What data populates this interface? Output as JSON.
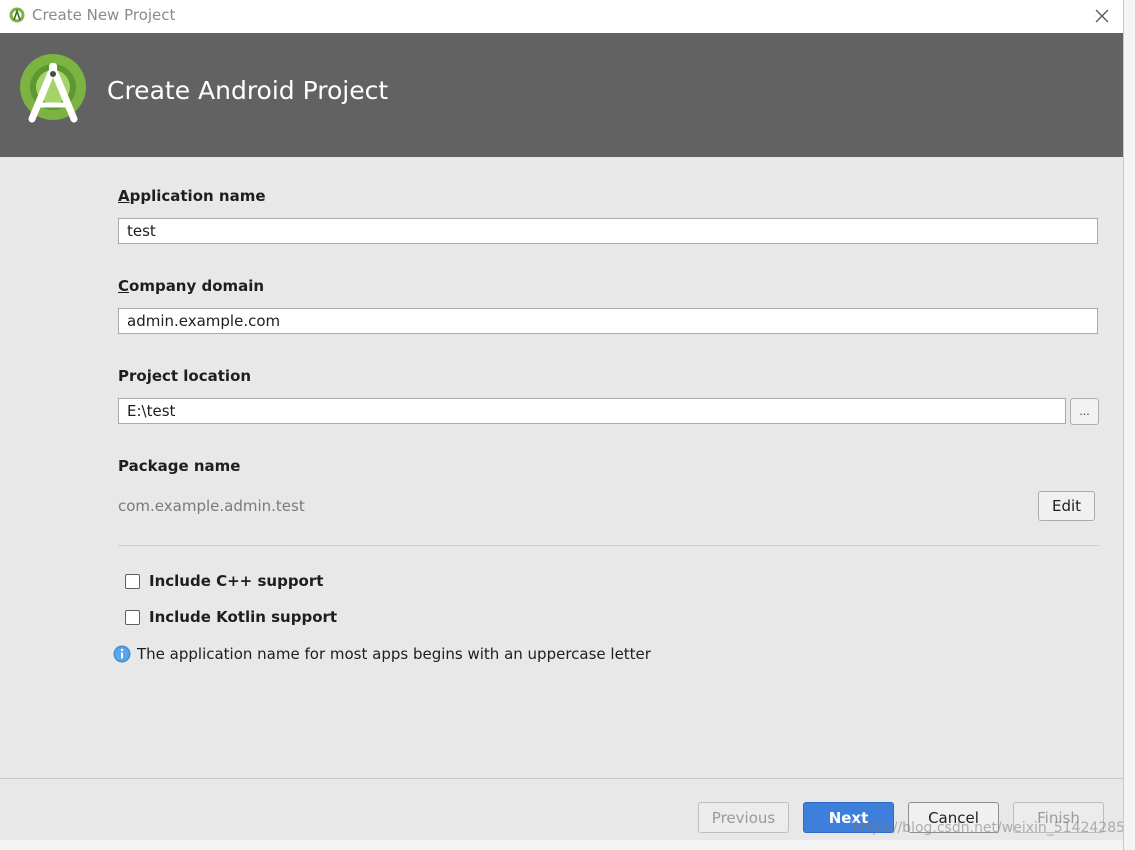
{
  "window": {
    "title": "Create New Project",
    "header_title": "Create Android Project"
  },
  "form": {
    "app_name": {
      "label_accesskey": "A",
      "label_rest": "pplication name",
      "value": "test"
    },
    "company_domain": {
      "label_accesskey": "C",
      "label_rest": "ompany domain",
      "value": "admin.example.com"
    },
    "project_location": {
      "label": "Project location",
      "value": "E:\\test",
      "browse_label": "..."
    },
    "package_name": {
      "label": "Package name",
      "value": "com.example.admin.test",
      "edit_label": "Edit"
    },
    "options": {
      "cpp": {
        "label": "Include C++ support",
        "checked": false
      },
      "kotlin": {
        "label": "Include Kotlin support",
        "checked": false
      }
    },
    "info_message": "The application name for most apps begins with an uppercase letter"
  },
  "footer": {
    "previous": "Previous",
    "next": "Next",
    "cancel": "Cancel",
    "finish": "Finish"
  },
  "watermark": "https://blog.csdn.net/weixin_51424285",
  "colors": {
    "header_bg": "#626262",
    "dialog_bg": "#e8e8e8",
    "primary_button": "#3f7fdc",
    "info_icon": "#3d8fd8",
    "logo_green": "#7cb342"
  },
  "icons": {
    "title": "android-studio-icon",
    "close": "close-icon",
    "logo": "android-studio-logo",
    "info": "info-icon"
  }
}
